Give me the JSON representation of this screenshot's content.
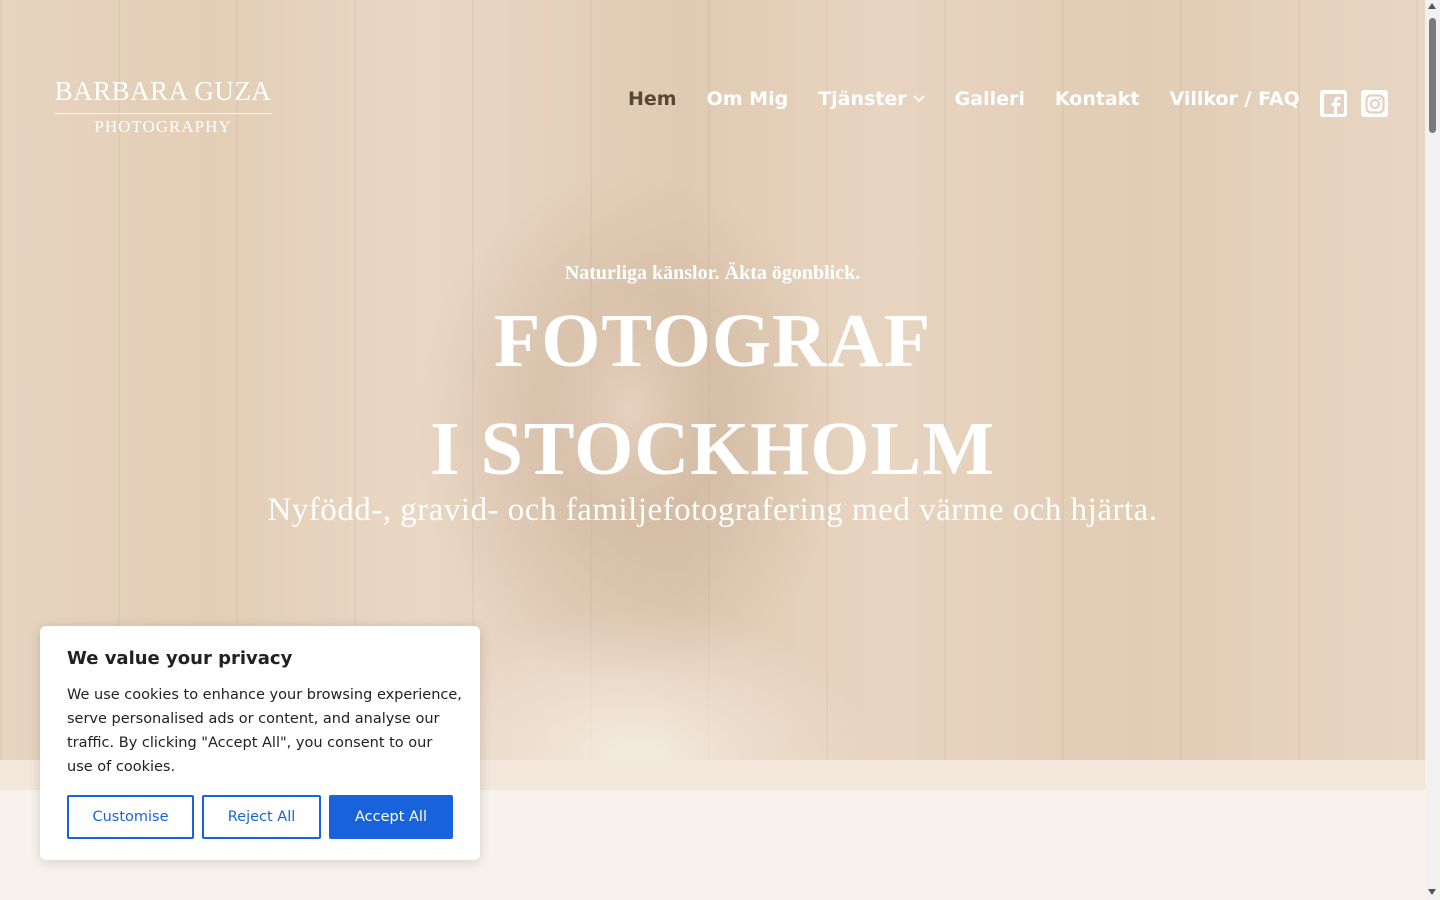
{
  "brand": {
    "name": "BARBARA GUZA",
    "subtitle": "PHOTOGRAPHY"
  },
  "nav": {
    "items": [
      {
        "label": "Hem",
        "active": true
      },
      {
        "label": "Om Mig"
      },
      {
        "label": "Tjänster",
        "has_dropdown": true
      },
      {
        "label": "Galleri"
      },
      {
        "label": "Kontakt"
      },
      {
        "label": "Villkor / FAQ"
      }
    ],
    "social": [
      "facebook-icon",
      "instagram-icon"
    ]
  },
  "hero": {
    "tagline": "Naturliga känslor. Äkta ögonblick.",
    "title_line1": "FOTOGRAF",
    "title_line2": "I STOCKHOLM",
    "subtitle": "Nyfödd-, gravid- och familjefotografering med värme och hjärta."
  },
  "cookie": {
    "title": "We value your privacy",
    "body": "We use cookies to enhance your browsing experience, serve personalised ads or content, and analyse our traffic. By clicking \"Accept All\", you consent to our use of cookies.",
    "customise": "Customise",
    "reject": "Reject All",
    "accept": "Accept All"
  },
  "colors": {
    "accent": "#1863dc",
    "active_nav": "#5a4636",
    "band": "#f3e7dc",
    "page_bg": "#f9f2ec"
  }
}
